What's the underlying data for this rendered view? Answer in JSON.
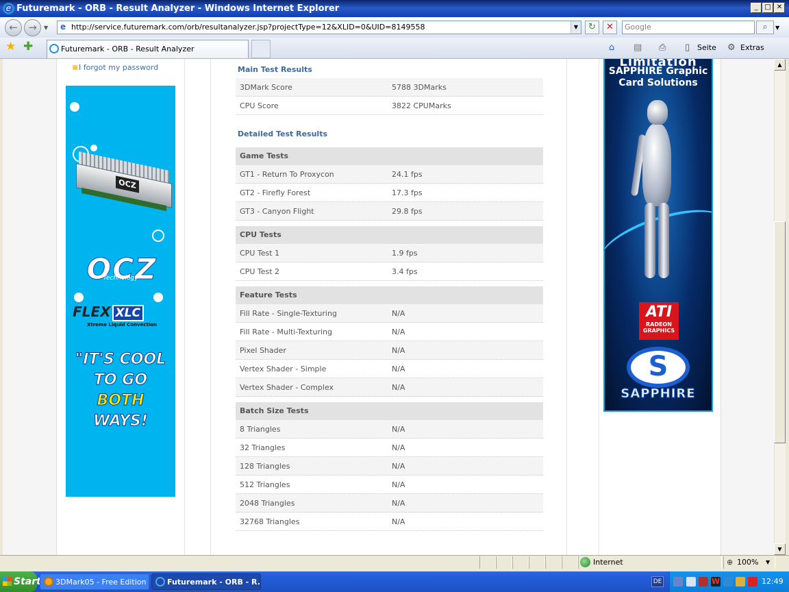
{
  "window": {
    "title": "Futuremark - ORB - Result Analyzer - Windows Internet Explorer",
    "controls": {
      "minimize": "_",
      "maximize": "□",
      "close": "✕"
    }
  },
  "toolbar": {
    "address": "http://service.futuremark.com/orb/resultanalyzer.jsp?projectType=12&XLID=0&UID=8149558",
    "search_placeholder": "Google",
    "back_icon": "back-arrow-icon",
    "forward_icon": "forward-arrow-icon",
    "refresh_glyph": "↻",
    "stop_glyph": "✕"
  },
  "tabs": {
    "active_label": "Futuremark - ORB - Result Analyzer",
    "page_menu": "Seite",
    "tools_menu": "Extras"
  },
  "sidebar": {
    "forgot_password": "I forgot my password",
    "ad_left": {
      "brand": "OCZ",
      "tech": "Technology",
      "flex": "FLEX",
      "xlc": "XLC",
      "xtreme": "Xtreme Liquid Convection",
      "slogan_1": "\"IT'S COOL",
      "slogan_2": "TO GO",
      "slogan_3": "BOTH",
      "slogan_4": "WAYS!",
      "ram_label": "OCZ"
    },
    "ad_right": {
      "top": "Limitation",
      "title": "SAPPHIRE Graphic Card Solutions",
      "ati": "ATI",
      "radeon": "RADEON GRAPHICS",
      "brand": "SAPPHIRE",
      "logo_letter": "S"
    }
  },
  "results": {
    "main_title": "Main Test Results",
    "main": [
      {
        "label": "3DMark Score",
        "value": "5788 3DMarks"
      },
      {
        "label": "CPU Score",
        "value": "3822 CPUMarks"
      }
    ],
    "detailed_title": "Detailed Test Results",
    "groups": [
      {
        "title": "Game Tests",
        "rows": [
          {
            "label": "GT1 - Return To Proxycon",
            "value": "24.1 fps"
          },
          {
            "label": "GT2 - Firefly Forest",
            "value": "17.3 fps"
          },
          {
            "label": "GT3 - Canyon Flight",
            "value": "29.8 fps"
          }
        ]
      },
      {
        "title": "CPU Tests",
        "rows": [
          {
            "label": "CPU Test 1",
            "value": "1.9 fps"
          },
          {
            "label": "CPU Test 2",
            "value": "3.4 fps"
          }
        ]
      },
      {
        "title": "Feature Tests",
        "rows": [
          {
            "label": "Fill Rate - Single-Texturing",
            "value": "N/A"
          },
          {
            "label": "Fill Rate - Multi-Texturing",
            "value": "N/A"
          },
          {
            "label": "Pixel Shader",
            "value": "N/A"
          },
          {
            "label": "Vertex Shader - Simple",
            "value": "N/A"
          },
          {
            "label": "Vertex Shader - Complex",
            "value": "N/A"
          }
        ]
      },
      {
        "title": "Batch Size Tests",
        "rows": [
          {
            "label": "8 Triangles",
            "value": "N/A"
          },
          {
            "label": "32 Triangles",
            "value": "N/A"
          },
          {
            "label": "128 Triangles",
            "value": "N/A"
          },
          {
            "label": "512 Triangles",
            "value": "N/A"
          },
          {
            "label": "2048 Triangles",
            "value": "N/A"
          },
          {
            "label": "32768 Triangles",
            "value": "N/A"
          }
        ]
      }
    ]
  },
  "statusbar": {
    "zone": "Internet",
    "zoom": "100%"
  },
  "taskbar": {
    "start": "Start",
    "items": [
      "3DMark05 - Free Edition",
      "Futuremark - ORB - R..."
    ],
    "language": "DE",
    "clock": "12:49"
  },
  "colors": {
    "link": "#3e6ea8",
    "section": "#3a69a3",
    "taskbar": "#245edb",
    "ocz_bg": "#00b5ef"
  }
}
